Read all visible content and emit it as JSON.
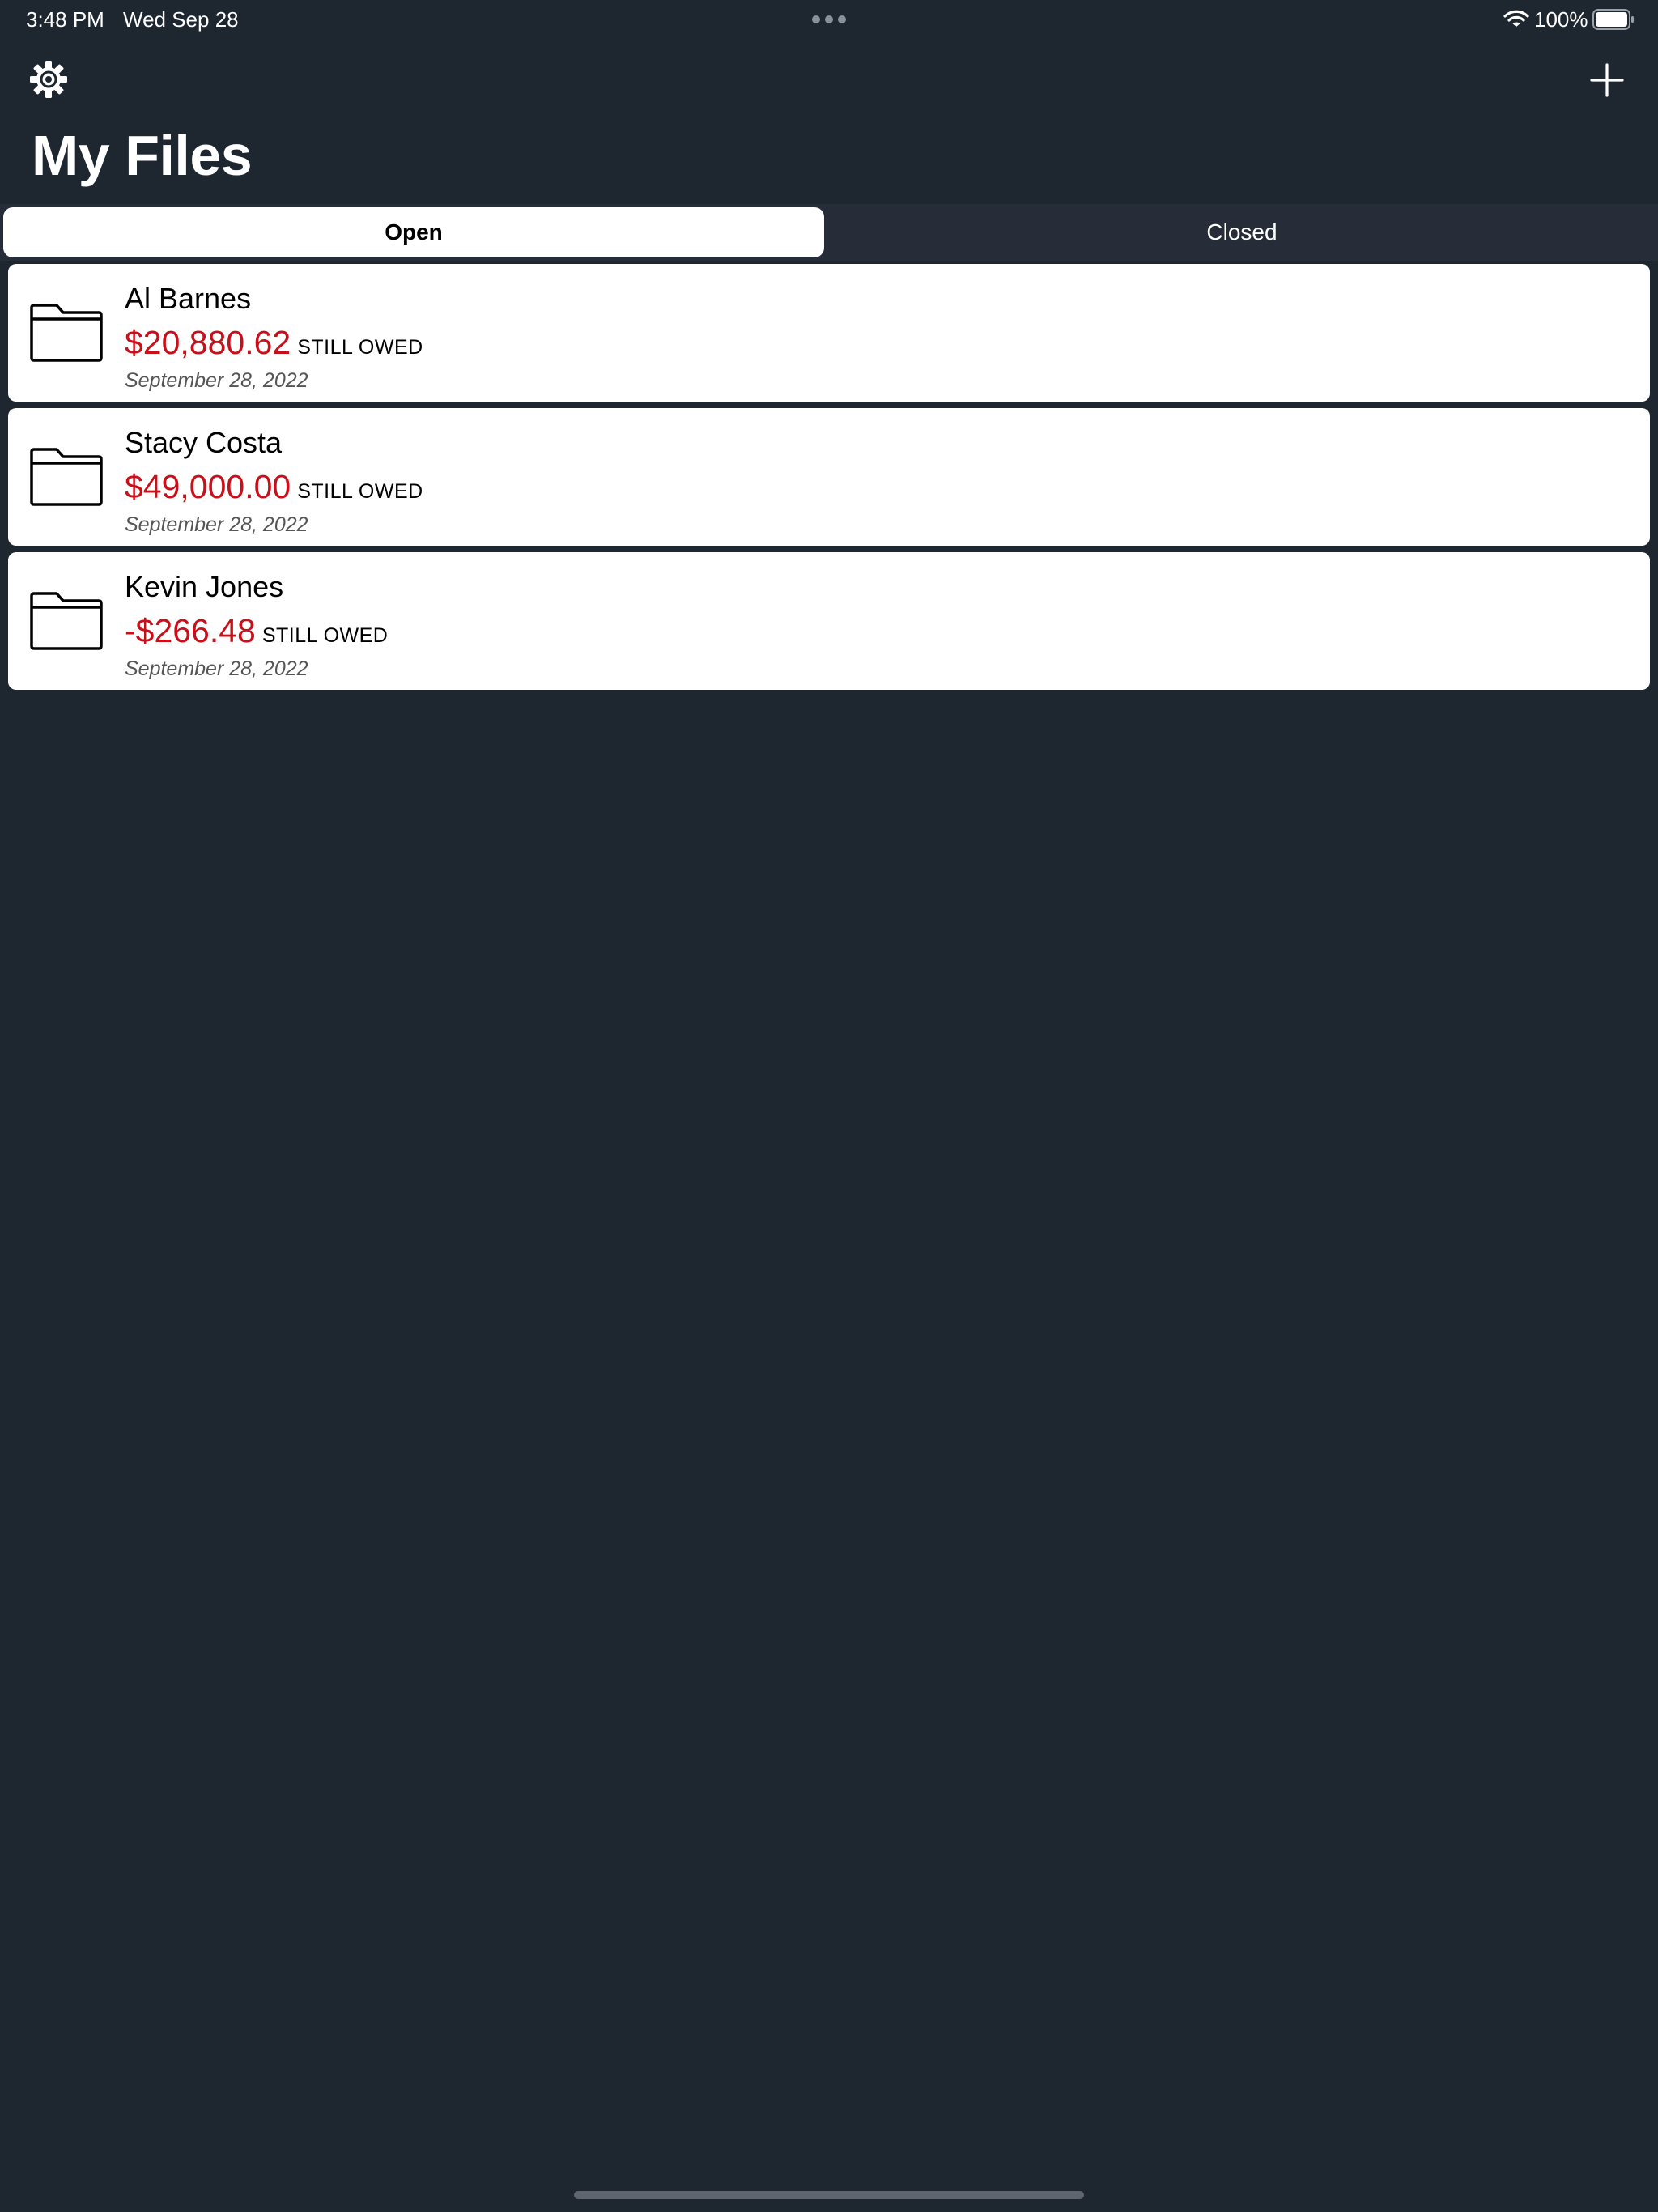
{
  "status_bar": {
    "time": "3:48 PM",
    "date": "Wed Sep 28",
    "battery_percent": "100%",
    "battery_level": 1.0,
    "icons": [
      "multitasking-dots-icon",
      "wifi-icon",
      "battery-icon"
    ]
  },
  "nav": {
    "left_icon": "gear-icon",
    "right_icon": "plus-icon",
    "title": "My Files"
  },
  "segments": {
    "open_label": "Open",
    "closed_label": "Closed",
    "selected": "Open"
  },
  "files": [
    {
      "name": "Al Barnes",
      "amount": "$20,880.62",
      "owed_label": "STILL OWED",
      "date": "September 28, 2022"
    },
    {
      "name": "Stacy Costa",
      "amount": "$49,000.00",
      "owed_label": "STILL OWED",
      "date": "September 28, 2022"
    },
    {
      "name": "Kevin Jones",
      "amount": "-$266.48",
      "owed_label": "STILL OWED",
      "date": "September 28, 2022"
    }
  ],
  "colors": {
    "background": "#1e2630",
    "amount": "#c8101a",
    "card": "#ffffff"
  }
}
